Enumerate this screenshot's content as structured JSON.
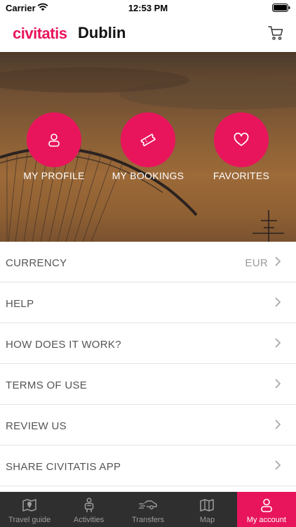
{
  "status_bar": {
    "carrier": "Carrier",
    "time": "12:53 PM"
  },
  "header": {
    "logo": "civitatis",
    "city": "Dublin",
    "cart_icon": "cart-icon"
  },
  "quick_actions": [
    {
      "label": "MY PROFILE",
      "icon": "user-icon"
    },
    {
      "label": "MY BOOKINGS",
      "icon": "ticket-icon"
    },
    {
      "label": "FAVORITES",
      "icon": "heart-icon"
    }
  ],
  "menu": [
    {
      "label": "CURRENCY",
      "value": "EUR"
    },
    {
      "label": "HELP"
    },
    {
      "label": "HOW DOES IT WORK?"
    },
    {
      "label": "TERMS OF USE"
    },
    {
      "label": "REVIEW US"
    },
    {
      "label": "SHARE CIVITATIS APP"
    }
  ],
  "tabs": [
    {
      "label": "Travel guide",
      "icon": "map-pin-icon",
      "active": false
    },
    {
      "label": "Activities",
      "icon": "traveler-icon",
      "active": false
    },
    {
      "label": "Transfers",
      "icon": "car-icon",
      "active": false
    },
    {
      "label": "Map",
      "icon": "map-icon",
      "active": false
    },
    {
      "label": "My account",
      "icon": "user-icon",
      "active": true
    }
  ],
  "colors": {
    "brand": "#e8155c",
    "tab_bar": "#2f2f2f",
    "separator": "#e4e4e4"
  }
}
